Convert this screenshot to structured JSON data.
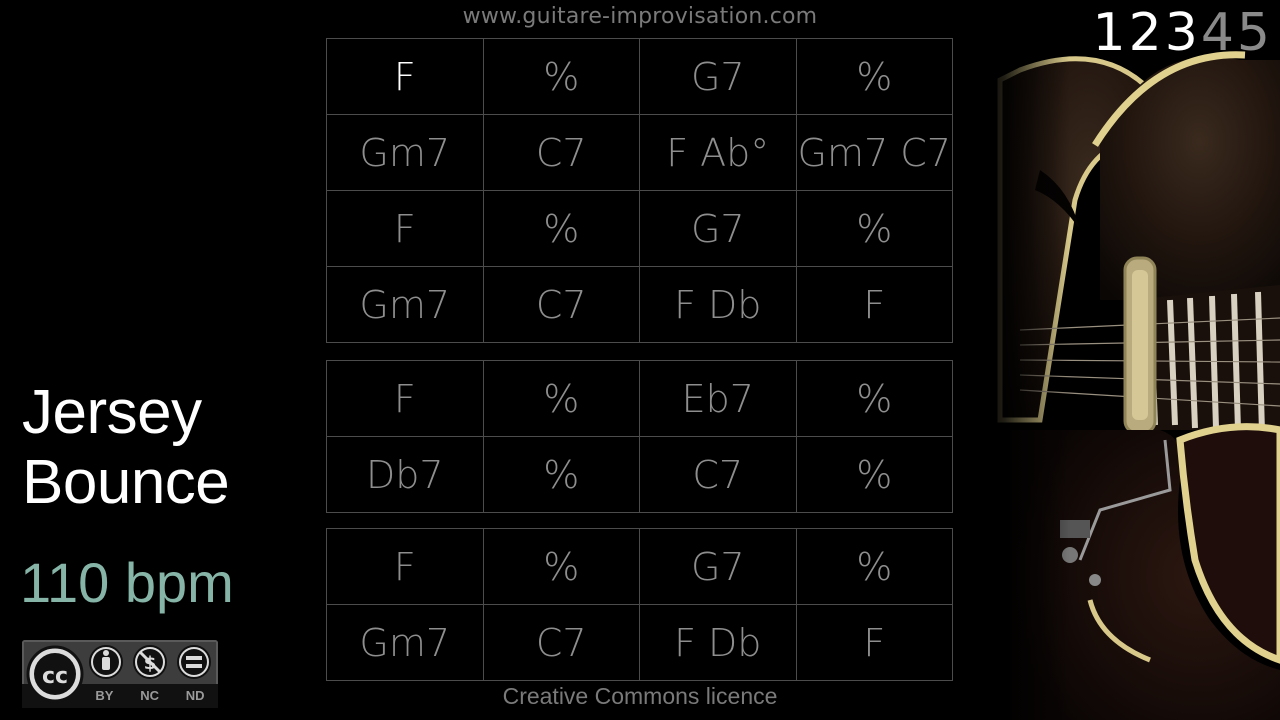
{
  "header": {
    "site_url": "www.guitare-improvisation.com"
  },
  "chorus_indicator": {
    "numbers": [
      "1",
      "2",
      "3",
      "4",
      "5"
    ],
    "active_through": 3
  },
  "song": {
    "title_line1": "Jersey",
    "title_line2": "Bounce",
    "tempo": "110 bpm"
  },
  "chord_grid": {
    "section_a": [
      [
        "F",
        "%",
        "G7",
        "%"
      ],
      [
        "Gm7",
        "C7",
        "F  Ab°",
        "Gm7 C7"
      ],
      [
        "F",
        "%",
        "G7",
        "%"
      ],
      [
        "Gm7",
        "C7",
        "F   Db",
        "F"
      ]
    ],
    "section_b": [
      [
        "F",
        "%",
        "Eb7",
        "%"
      ],
      [
        "Db7",
        "%",
        "C7",
        "%"
      ]
    ],
    "section_c": [
      [
        "F",
        "%",
        "G7",
        "%"
      ],
      [
        "Gm7",
        "C7",
        "F   Db",
        "F"
      ]
    ],
    "current_bar": "section_a.0.0"
  },
  "license": {
    "badge_labels": [
      "BY",
      "NC",
      "ND"
    ],
    "badge_icon": "creative-commons-by-nc-nd-icon",
    "caption": "Creative Commons licence"
  },
  "colors": {
    "background": "#000000",
    "chord_text": "#8e8e8e",
    "current_chord": "#ffffff",
    "tempo": "#86b5a8",
    "grid_line": "#4c4c4c"
  }
}
